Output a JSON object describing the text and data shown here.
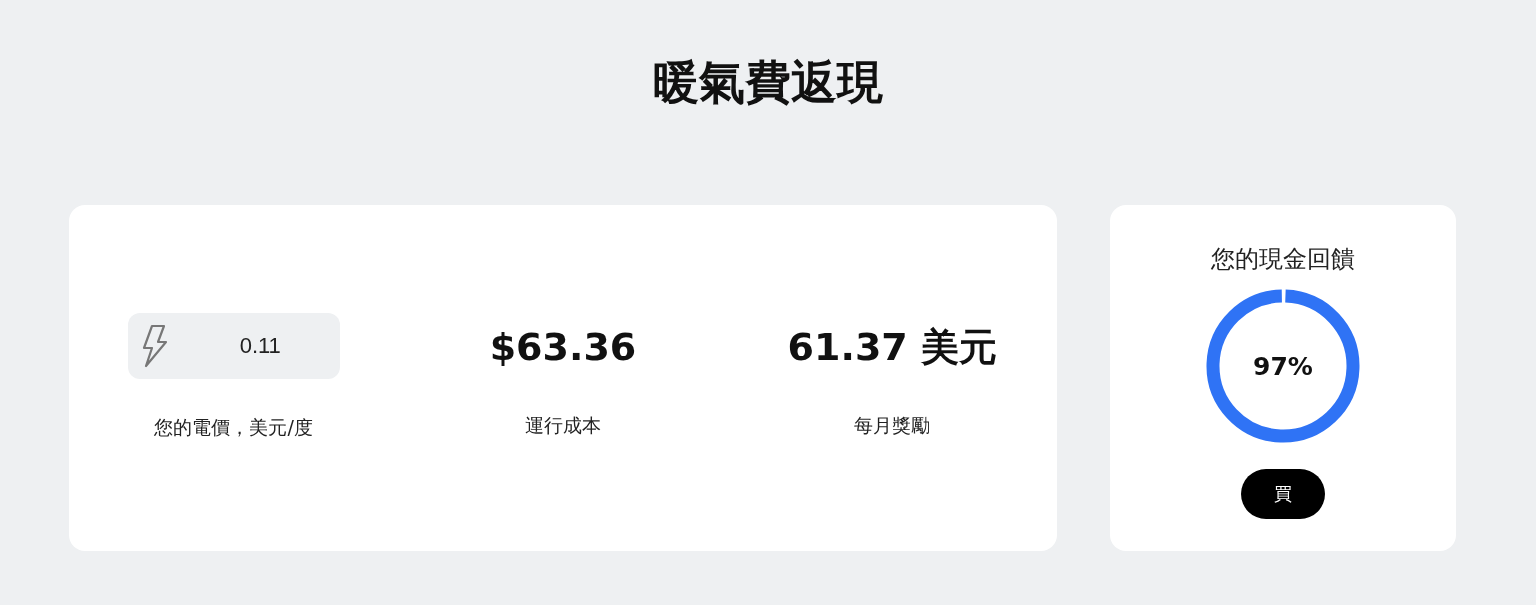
{
  "title": "暖氣費返現",
  "rate": {
    "value": "0.11",
    "label": "您的電價，美元/度"
  },
  "stats": [
    {
      "value": "$63.36",
      "label": "運行成本"
    },
    {
      "value": "61.37 美元",
      "label": "每月獎勵"
    }
  ],
  "cashback": {
    "title": "您的現金回饋",
    "reading": "97%",
    "button": "買"
  }
}
